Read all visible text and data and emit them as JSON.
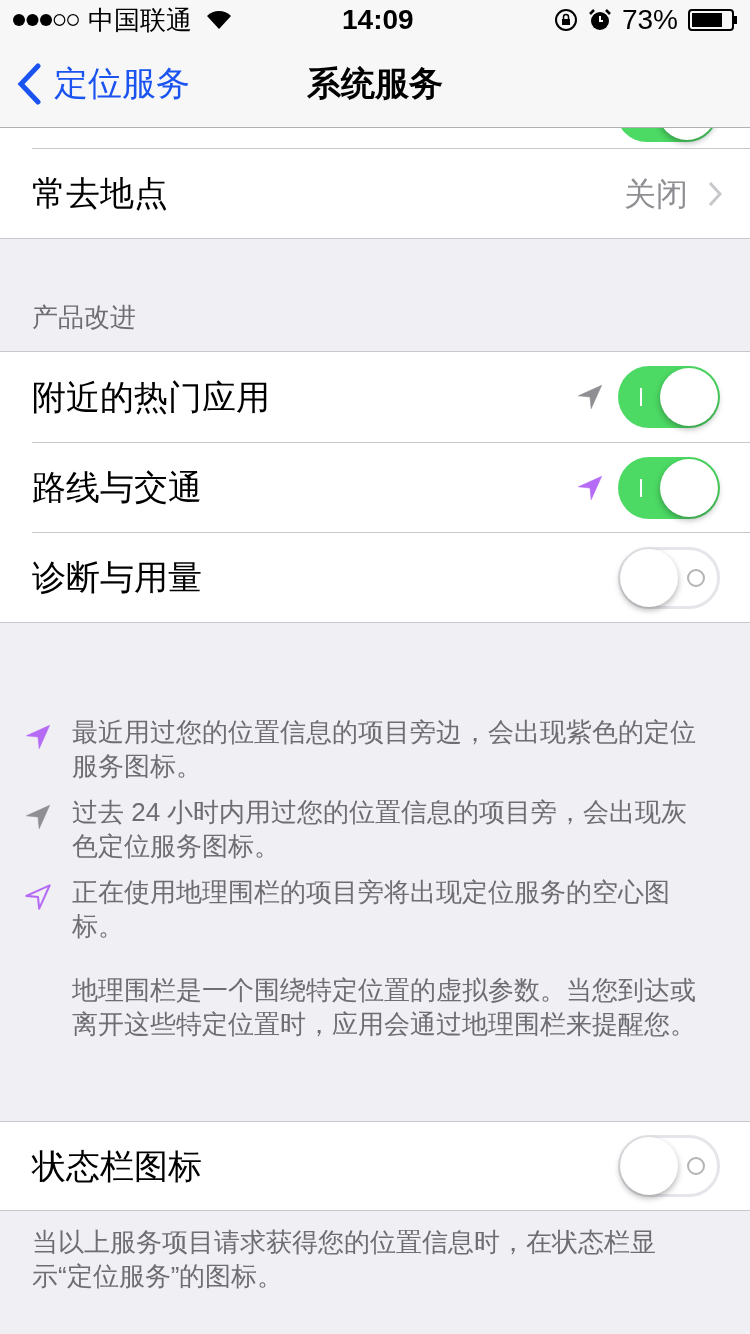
{
  "status_bar": {
    "carrier": "中国联通",
    "time": "14:09",
    "battery": "73%"
  },
  "nav": {
    "back": "定位服务",
    "title": "系统服务"
  },
  "top_row": {
    "on": true
  },
  "frequent": {
    "label": "常去地点",
    "value": "关闭"
  },
  "section": {
    "header": "产品改进",
    "rows": [
      {
        "label": "附近的热门应用",
        "color": "#8e8e93",
        "on": true
      },
      {
        "label": "路线与交通",
        "color": "#b56bf5",
        "on": true
      },
      {
        "label": "诊断与用量",
        "on": false
      }
    ]
  },
  "legend": [
    {
      "kind": "filled",
      "color": "#b56bf5",
      "text": "最近用过您的位置信息的项目旁边，会出现紫色的定位服务图标。"
    },
    {
      "kind": "filled",
      "color": "#8e8e93",
      "text": "过去 24 小时内用过您的位置信息的项目旁，会出现灰色定位服务图标。"
    },
    {
      "kind": "outline",
      "color": "#b56bf5",
      "text": "正在使用地理围栏的项目旁将出现定位服务的空心图标。"
    }
  ],
  "geofence_note": "地理围栏是一个围绕特定位置的虚拟参数。当您到达或离开这些特定位置时，应用会通过地理围栏来提醒您。",
  "status_icon_row": {
    "label": "状态栏图标",
    "on": false
  },
  "footer": "当以上服务项目请求获得您的位置信息时，在状态栏显示“定位服务”的图标。"
}
